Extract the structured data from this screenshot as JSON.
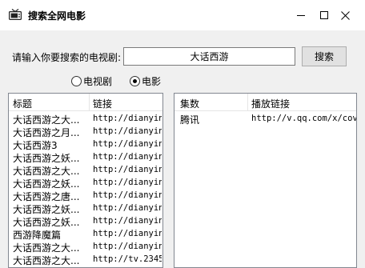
{
  "window": {
    "title": "搜索全网电影",
    "icon": "tv-icon",
    "controls": [
      "minimize-icon",
      "maximize-icon",
      "close-icon"
    ]
  },
  "search": {
    "label": "请输入你要搜索的电视剧:",
    "value": "大话西游",
    "button_label": "搜索"
  },
  "type_options": [
    {
      "label": "电视剧",
      "checked": false
    },
    {
      "label": "电影",
      "checked": true
    }
  ],
  "results": {
    "columns": [
      "标题",
      "链接"
    ],
    "rows": [
      {
        "title": "大话西游之大...",
        "link": "http://dianyin"
      },
      {
        "title": "大话西游之月...",
        "link": "http://dianyin"
      },
      {
        "title": "大话西游3",
        "link": "http://dianyin"
      },
      {
        "title": "大话西游之妖...",
        "link": "http://dianyin"
      },
      {
        "title": "大话西游之大...",
        "link": "http://dianyin"
      },
      {
        "title": "大话西游之妖...",
        "link": "http://dianyin"
      },
      {
        "title": "大话西游之唐...",
        "link": "http://dianyin"
      },
      {
        "title": "大话西游之妖...",
        "link": "http://dianyin"
      },
      {
        "title": "大话西游之妖...",
        "link": "http://dianyin"
      },
      {
        "title": "西游降魔篇",
        "link": "http://dianyin"
      },
      {
        "title": "大话西游之大...",
        "link": "http://dianyin"
      },
      {
        "title": "大话西游之大...",
        "link": "http://tv.2345"
      }
    ]
  },
  "episodes": {
    "columns": [
      "集数",
      "播放链接"
    ],
    "rows": [
      {
        "episode": "腾讯",
        "link": "http://v.qq.com/x/cov"
      }
    ]
  }
}
